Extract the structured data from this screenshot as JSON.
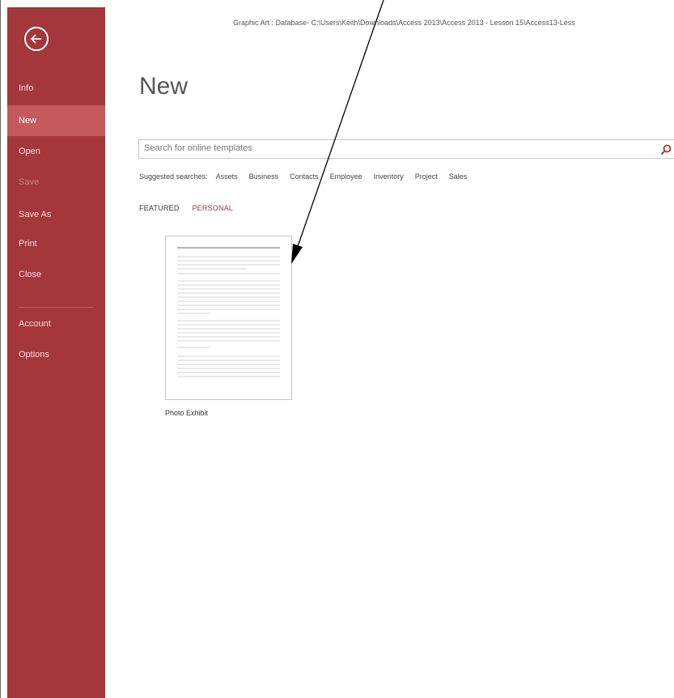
{
  "window": {
    "title": "Graphic Art : Database- C:\\Users\\Keith\\Downloads\\Access 2013\\Access 2013 - Lesson 15\\Access13-Less"
  },
  "sidebar": {
    "back_icon": "back-arrow-icon",
    "items": [
      {
        "label": "Info",
        "state": "normal"
      },
      {
        "label": "New",
        "state": "active"
      },
      {
        "label": "Open",
        "state": "normal"
      },
      {
        "label": "Save",
        "state": "disabled"
      },
      {
        "label": "Save As",
        "state": "normal"
      },
      {
        "label": "Print",
        "state": "normal"
      },
      {
        "label": "Close",
        "state": "normal"
      },
      {
        "label": "Account",
        "state": "normal"
      },
      {
        "label": "Options",
        "state": "normal"
      }
    ]
  },
  "main": {
    "title": "New",
    "search": {
      "placeholder": "Search for online templates",
      "icon": "search-icon"
    },
    "suggested": {
      "label": "Suggested searches:",
      "links": [
        "Assets",
        "Business",
        "Contacts",
        "Employee",
        "Inventory",
        "Project",
        "Sales"
      ]
    },
    "tabs": [
      {
        "label": "FEATURED",
        "active": false
      },
      {
        "label": "PERSONAL",
        "active": true
      }
    ],
    "templates": [
      {
        "name": "Photo Exhibit"
      }
    ]
  },
  "colors": {
    "sidebar_bg": "#a4373a",
    "sidebar_active": "#c55a5c",
    "accent": "#a4373a"
  }
}
